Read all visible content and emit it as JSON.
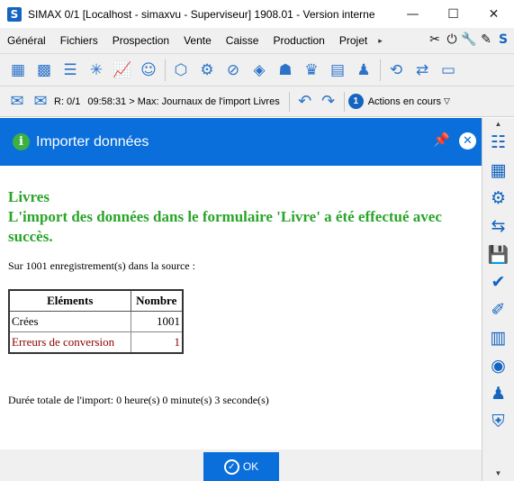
{
  "window": {
    "app_icon_letter": "S",
    "title": "SIMAX 0/1 [Localhost - simaxvu - Superviseur] 1908.01 - Version interne",
    "minimize": "—",
    "maximize": "☐",
    "close": "✕"
  },
  "menu": {
    "items": [
      "Général",
      "Fichiers",
      "Prospection",
      "Vente",
      "Caisse",
      "Production",
      "Projet"
    ],
    "overflow_arrow": "▸",
    "tool_icons": [
      "tools-icon",
      "plug-icon",
      "wrench-icon",
      "pen-icon",
      "brand-s-icon"
    ]
  },
  "toolbar": {
    "icons": [
      "calendar-icon",
      "grid-icon",
      "list-icon",
      "sparkle-icon",
      "chart-icon",
      "people-group-icon",
      "box-icon",
      "gear-icon",
      "tag-icon",
      "price-tag-icon",
      "person-card-icon",
      "team-icon",
      "shop-icon",
      "person-icon",
      "sync-clock-icon",
      "share-icon",
      "briefcase-icon"
    ]
  },
  "status": {
    "mail_count": "R: 0/1",
    "message": "09:58:31 > Max: Journaux de l'import Livres",
    "actions_count": "1",
    "actions_label": "Actions en cours"
  },
  "dialog": {
    "title": "Importer données",
    "heading_line1": "Livres",
    "heading_line2": "L'import des données dans le formulaire 'Livre' a été effectué avec succès.",
    "source_line": "Sur 1001 enregistrement(s) dans la source :",
    "table": {
      "headers": [
        "Eléments",
        "Nombre"
      ],
      "rows": [
        {
          "label": "Crées",
          "value": "1001"
        },
        {
          "label": "Erreurs de conversion",
          "value": "1"
        }
      ]
    },
    "duration": "Durée totale de l'import: 0 heure(s) 0 minute(s) 3 seconde(s)",
    "ok_label": "OK"
  },
  "sidebar": {
    "icons": [
      "table-view-icon",
      "grid-view-icon",
      "settings-icon",
      "transfer-icon",
      "save-icon",
      "check-badge-icon",
      "brush-icon",
      "layout-icon",
      "preview-icon",
      "user-icon",
      "user-shield-icon"
    ]
  },
  "colors": {
    "accent": "#0a6fdb",
    "success_green": "#2aa52a",
    "error_red": "#8b0000"
  }
}
